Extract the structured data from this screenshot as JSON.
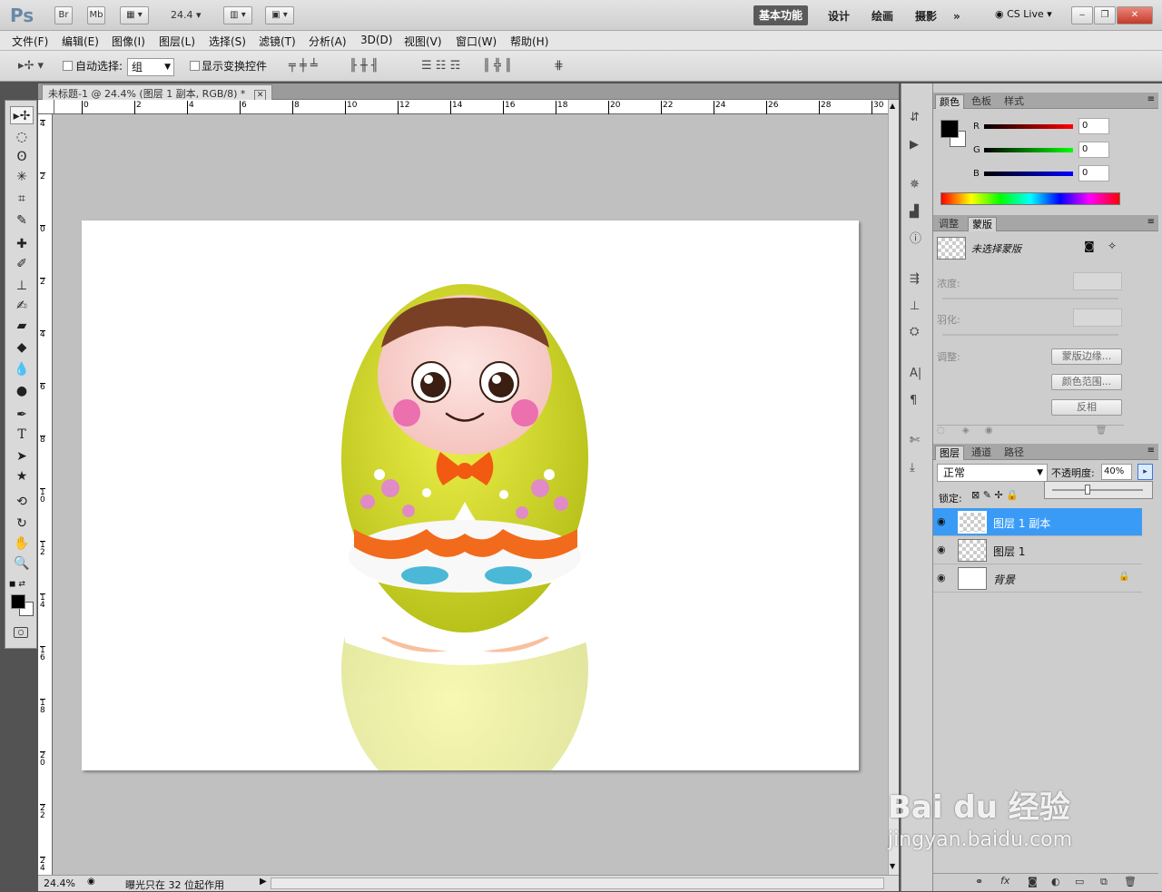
{
  "app": {
    "logo": "Ps",
    "bridge": "Br",
    "minibridge": "Mb",
    "zoom": "24.4"
  },
  "workspaces": [
    "基本功能",
    "设计",
    "绘画",
    "摄影"
  ],
  "cslive": "CS Live",
  "menu": [
    "文件(F)",
    "编辑(E)",
    "图像(I)",
    "图层(L)",
    "选择(S)",
    "滤镜(T)",
    "分析(A)",
    "3D(D)",
    "视图(V)",
    "窗口(W)",
    "帮助(H)"
  ],
  "options": {
    "auto_select_label": "自动选择:",
    "auto_select_value": "组",
    "show_transform": "显示变换控件"
  },
  "document": {
    "tab_title": "未标题-1 @ 24.4% (图层 1 副本, RGB/8) *",
    "status_zoom": "24.4%",
    "status_text": "曝光只在 32 位起作用"
  },
  "rulers": {
    "h": [
      "0",
      "2",
      "4",
      "6",
      "8",
      "10",
      "12",
      "14",
      "16",
      "18",
      "20",
      "22",
      "24",
      "26",
      "28",
      "30"
    ],
    "v": [
      "4",
      "2",
      "0",
      "2",
      "4",
      "6",
      "8",
      "1\n0",
      "1\n2",
      "1\n4",
      "1\n6",
      "1\n8",
      "2\n0",
      "2\n2",
      "2\n4"
    ]
  },
  "color_panel": {
    "tabs": [
      "颜色",
      "色板",
      "样式"
    ],
    "r": "0",
    "g": "0",
    "b": "0",
    "r_label": "R",
    "g_label": "G",
    "b_label": "B"
  },
  "masks_panel": {
    "tabs": [
      "调整",
      "蒙版"
    ],
    "no_mask": "未选择蒙版",
    "density": "浓度:",
    "feather": "羽化:",
    "adjust": "调整:",
    "btn_edge": "蒙版边缘...",
    "btn_range": "颜色范围...",
    "btn_invert": "反相"
  },
  "layers_panel": {
    "tabs": [
      "图层",
      "通道",
      "路径"
    ],
    "blend": "正常",
    "opacity_label": "不透明度:",
    "opacity_value": "40%",
    "lock_label": "锁定:",
    "layers": [
      {
        "name": "图层 1 副本",
        "selected": true
      },
      {
        "name": "图层 1",
        "selected": false
      },
      {
        "name": "背景",
        "selected": false,
        "italic": true
      }
    ]
  },
  "watermark": {
    "brand": "Bai du 经验",
    "url": "jingyan.baidu.com"
  },
  "colors": {
    "accent": "#3c98f5",
    "selected_layer": "#3a9bf7"
  }
}
